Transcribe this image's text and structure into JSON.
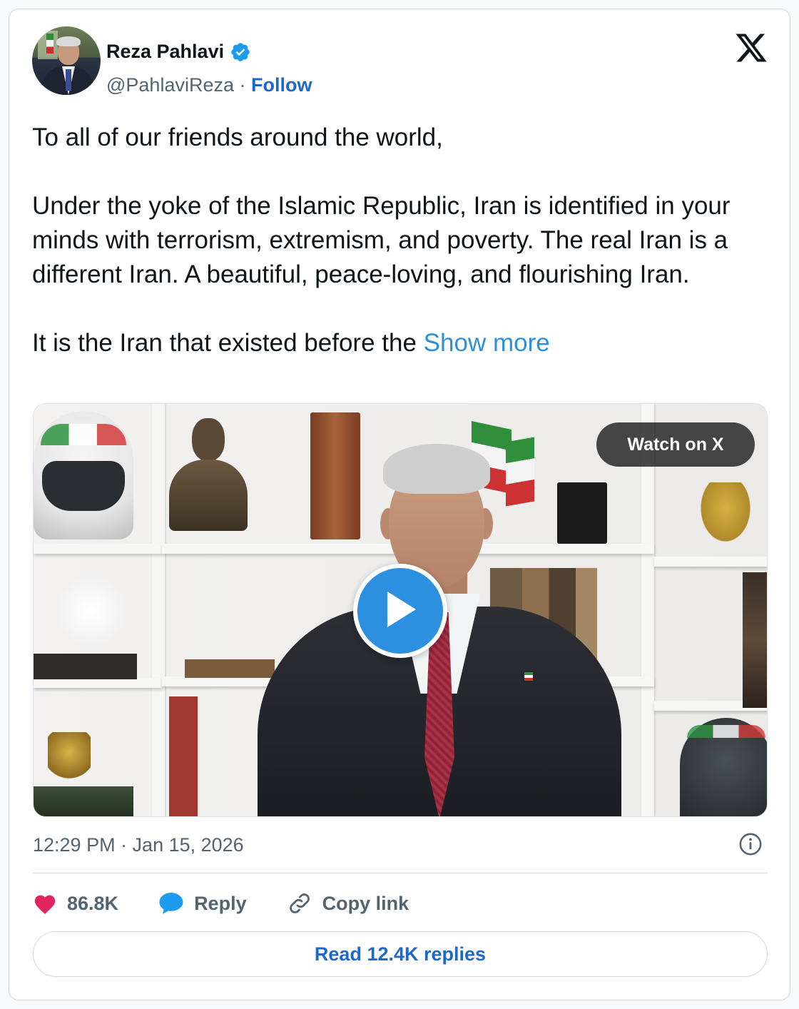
{
  "author": {
    "display_name": "Reza Pahlavi",
    "handle": "@PahlaviReza",
    "separator": "·",
    "follow_label": "Follow"
  },
  "tweet": {
    "line1": "To all of our friends around the world,",
    "para2": "Under the yoke of the Islamic Republic, Iran is identified in your minds with terrorism, extremism, and poverty. The real Iran is a different Iran. A beautiful, peace-loving, and flourishing Iran.",
    "para3": "It is the Iran that existed before the",
    "show_more": "Show more"
  },
  "video": {
    "watch_label": "Watch on X"
  },
  "meta": {
    "timestamp": "12:29 PM · Jan 15, 2026"
  },
  "actions": {
    "likes": "86.8K",
    "reply_label": "Reply",
    "copy_link_label": "Copy link"
  },
  "read_replies_label": "Read 12.4K replies",
  "colors": {
    "link_blue": "#1d68c9",
    "accent_blue": "#2d8fe0",
    "like_pink": "#e0245e",
    "muted": "#536471"
  },
  "icons": [
    "verified-badge-icon",
    "x-logo-icon",
    "play-icon",
    "info-icon",
    "heart-icon",
    "reply-bubble-icon",
    "link-icon"
  ]
}
